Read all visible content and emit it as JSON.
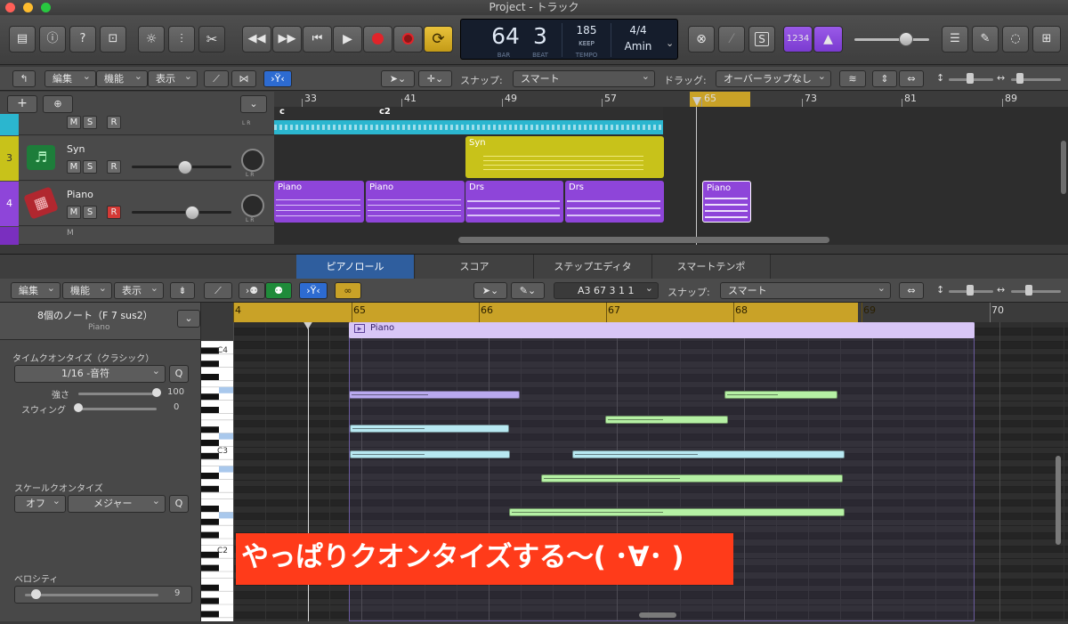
{
  "window": {
    "title": "Project - トラック"
  },
  "lcd": {
    "bar": "64",
    "beat": "3",
    "bar_label": "BAR",
    "beat_label": "BEAT",
    "tempo": "185",
    "tempo_keep": "KEEP",
    "tempo_label": "TEMPO",
    "signature": "4/4",
    "key": "Amin"
  },
  "control_bar": {
    "count_in": "1234",
    "solo_s": "S"
  },
  "tracks_toolbar": {
    "edit": "編集",
    "function": "機能",
    "view": "表示",
    "snap_label": "スナップ:",
    "snap_value": "スマート",
    "drag_label": "ドラッグ:",
    "drag_value": "オーバーラップなし"
  },
  "ruler_top": {
    "bars": [
      "33",
      "41",
      "49",
      "57",
      "65",
      "73",
      "81",
      "89"
    ]
  },
  "tracks": [
    {
      "number": "3",
      "name": "Syn",
      "m": "M",
      "s": "S",
      "r": "R",
      "lr": "L R"
    },
    {
      "number": "4",
      "name": "Piano",
      "m": "M",
      "s": "S",
      "r": "R",
      "lr": "L R"
    },
    {
      "m": "M",
      "s": "S",
      "r": "R",
      "lr": "L R",
      "partial": "M"
    }
  ],
  "arrange": {
    "markers": [
      "c",
      "c2"
    ],
    "regions": {
      "syn": "Syn",
      "piano1": "Piano",
      "piano2": "Piano",
      "drs1": "Drs",
      "drs2": "Drs",
      "piano3": "Piano"
    }
  },
  "editor_tabs": [
    "ピアノロール",
    "スコア",
    "ステップエディタ",
    "スマートテンポ"
  ],
  "piano_toolbar": {
    "edit": "編集",
    "function": "機能",
    "view": "表示",
    "position": "A3   67 3 1 1",
    "snap_label": "スナップ:",
    "snap_value": "スマート"
  },
  "inspector": {
    "header": "8個のノート（F 7 sus2）",
    "subheader": "Piano",
    "time_quantize": "タイムクオンタイズ（クラシック）",
    "quantize_value": "1/16 -音符",
    "q": "Q",
    "strength_label": "強さ",
    "strength_value": "100",
    "swing_label": "スウィング",
    "swing_value": "0",
    "scale_quantize": "スケールクオンタイズ",
    "scale_off": "オフ",
    "scale_type": "メジャー",
    "velocity_label": "ベロシティ",
    "velocity_value": "9"
  },
  "keyboard": {
    "c4": "C4",
    "c3": "C3",
    "c2": "C2"
  },
  "ruler_piano": {
    "bars": [
      "4",
      "65",
      "66",
      "67",
      "68",
      "69",
      "70"
    ],
    "region_name": "Piano"
  },
  "banner": {
    "text": "やっぱりクオンタイズする〜( ･∀･ )"
  },
  "colors": {
    "syn": "#c8c21a",
    "piano": "#8e45d9",
    "cyan": "#2bb6cf",
    "playhead_gold": "#c9a227",
    "note_green": "#b5f0a4",
    "note_blue": "#b7e8f1",
    "note_violet": "#b9a9ef",
    "banner": "#ff3b1a"
  }
}
